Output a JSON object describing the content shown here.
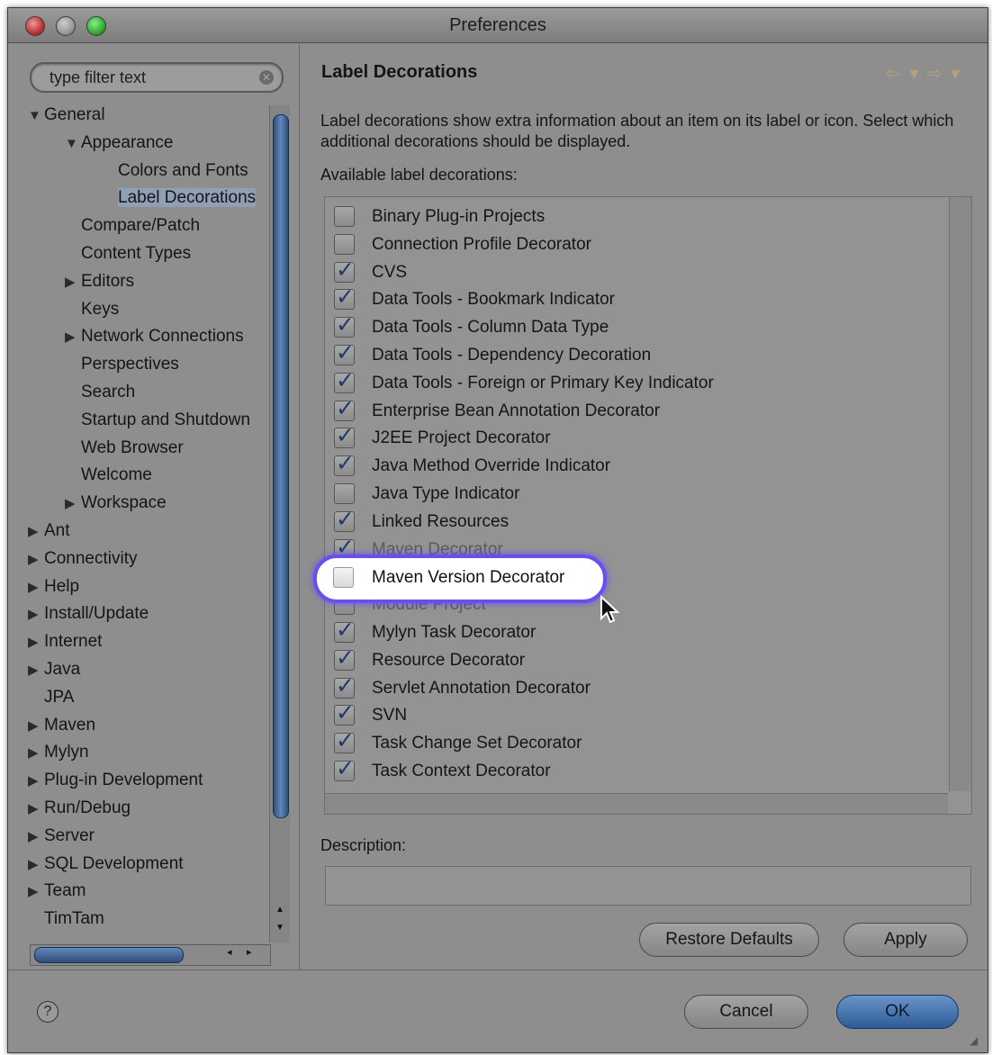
{
  "window": {
    "title": "Preferences"
  },
  "filter": {
    "placeholder": "type filter text"
  },
  "tree": [
    {
      "label": "General",
      "level": 0,
      "twisty": "open"
    },
    {
      "label": "Appearance",
      "level": 1,
      "twisty": "open"
    },
    {
      "label": "Colors and Fonts",
      "level": 2,
      "twisty": "none"
    },
    {
      "label": "Label Decorations",
      "level": 2,
      "twisty": "none",
      "selected": true
    },
    {
      "label": "Compare/Patch",
      "level": 1,
      "twisty": "none"
    },
    {
      "label": "Content Types",
      "level": 1,
      "twisty": "none"
    },
    {
      "label": "Editors",
      "level": 1,
      "twisty": "closed"
    },
    {
      "label": "Keys",
      "level": 1,
      "twisty": "none"
    },
    {
      "label": "Network Connections",
      "level": 1,
      "twisty": "closed"
    },
    {
      "label": "Perspectives",
      "level": 1,
      "twisty": "none"
    },
    {
      "label": "Search",
      "level": 1,
      "twisty": "none"
    },
    {
      "label": "Startup and Shutdown",
      "level": 1,
      "twisty": "none"
    },
    {
      "label": "Web Browser",
      "level": 1,
      "twisty": "none"
    },
    {
      "label": "Welcome",
      "level": 1,
      "twisty": "none"
    },
    {
      "label": "Workspace",
      "level": 1,
      "twisty": "closed"
    },
    {
      "label": "Ant",
      "level": 0,
      "twisty": "closed"
    },
    {
      "label": "Connectivity",
      "level": 0,
      "twisty": "closed"
    },
    {
      "label": "Help",
      "level": 0,
      "twisty": "closed"
    },
    {
      "label": "Install/Update",
      "level": 0,
      "twisty": "closed"
    },
    {
      "label": "Internet",
      "level": 0,
      "twisty": "closed"
    },
    {
      "label": "Java",
      "level": 0,
      "twisty": "closed"
    },
    {
      "label": "JPA",
      "level": 0,
      "twisty": "none"
    },
    {
      "label": "Maven",
      "level": 0,
      "twisty": "closed"
    },
    {
      "label": "Mylyn",
      "level": 0,
      "twisty": "closed"
    },
    {
      "label": "Plug-in Development",
      "level": 0,
      "twisty": "closed"
    },
    {
      "label": "Run/Debug",
      "level": 0,
      "twisty": "closed"
    },
    {
      "label": "Server",
      "level": 0,
      "twisty": "closed"
    },
    {
      "label": "SQL Development",
      "level": 0,
      "twisty": "closed"
    },
    {
      "label": "Team",
      "level": 0,
      "twisty": "closed"
    },
    {
      "label": "TimTam",
      "level": 0,
      "twisty": "none"
    }
  ],
  "page": {
    "title": "Label Decorations",
    "description": "Label decorations show extra information about an item on its label or icon. Select which additional decorations should be displayed.",
    "available_label": "Available label decorations:",
    "description_label": "Description:",
    "description_value": ""
  },
  "decorations": [
    {
      "label": "Binary Plug-in Projects",
      "checked": false
    },
    {
      "label": "Connection Profile Decorator",
      "checked": false
    },
    {
      "label": "CVS",
      "checked": true
    },
    {
      "label": "Data Tools - Bookmark Indicator",
      "checked": true
    },
    {
      "label": "Data Tools - Column Data Type",
      "checked": true
    },
    {
      "label": "Data Tools - Dependency Decoration",
      "checked": true
    },
    {
      "label": "Data Tools - Foreign or Primary Key Indicator",
      "checked": true
    },
    {
      "label": "Enterprise Bean Annotation Decorator",
      "checked": true
    },
    {
      "label": "J2EE Project Decorator",
      "checked": true
    },
    {
      "label": "Java Method Override Indicator",
      "checked": true
    },
    {
      "label": "Java Type Indicator",
      "checked": false
    },
    {
      "label": "Linked Resources",
      "checked": true
    },
    {
      "label": "Maven Decorator",
      "checked": true,
      "faded": true
    },
    {
      "label": "Maven Version Decorator",
      "checked": false,
      "highlighted": true
    },
    {
      "label": "Module Project",
      "checked": false,
      "faded": true
    },
    {
      "label": "Mylyn Task Decorator",
      "checked": true
    },
    {
      "label": "Resource Decorator",
      "checked": true
    },
    {
      "label": "Servlet Annotation Decorator",
      "checked": true
    },
    {
      "label": "SVN",
      "checked": true
    },
    {
      "label": "Task Change Set Decorator",
      "checked": true
    },
    {
      "label": "Task Context Decorator",
      "checked": true
    }
  ],
  "buttons": {
    "restore_defaults": "Restore Defaults",
    "apply": "Apply",
    "cancel": "Cancel",
    "ok": "OK"
  },
  "icons": {
    "help": "?",
    "back_forward": "⇦ ▾ ⇨ ▾"
  },
  "colors": {
    "highlight_ring": "#6a4ef0",
    "check": "#1f3b6a",
    "ok_button": "#2d5b98"
  }
}
